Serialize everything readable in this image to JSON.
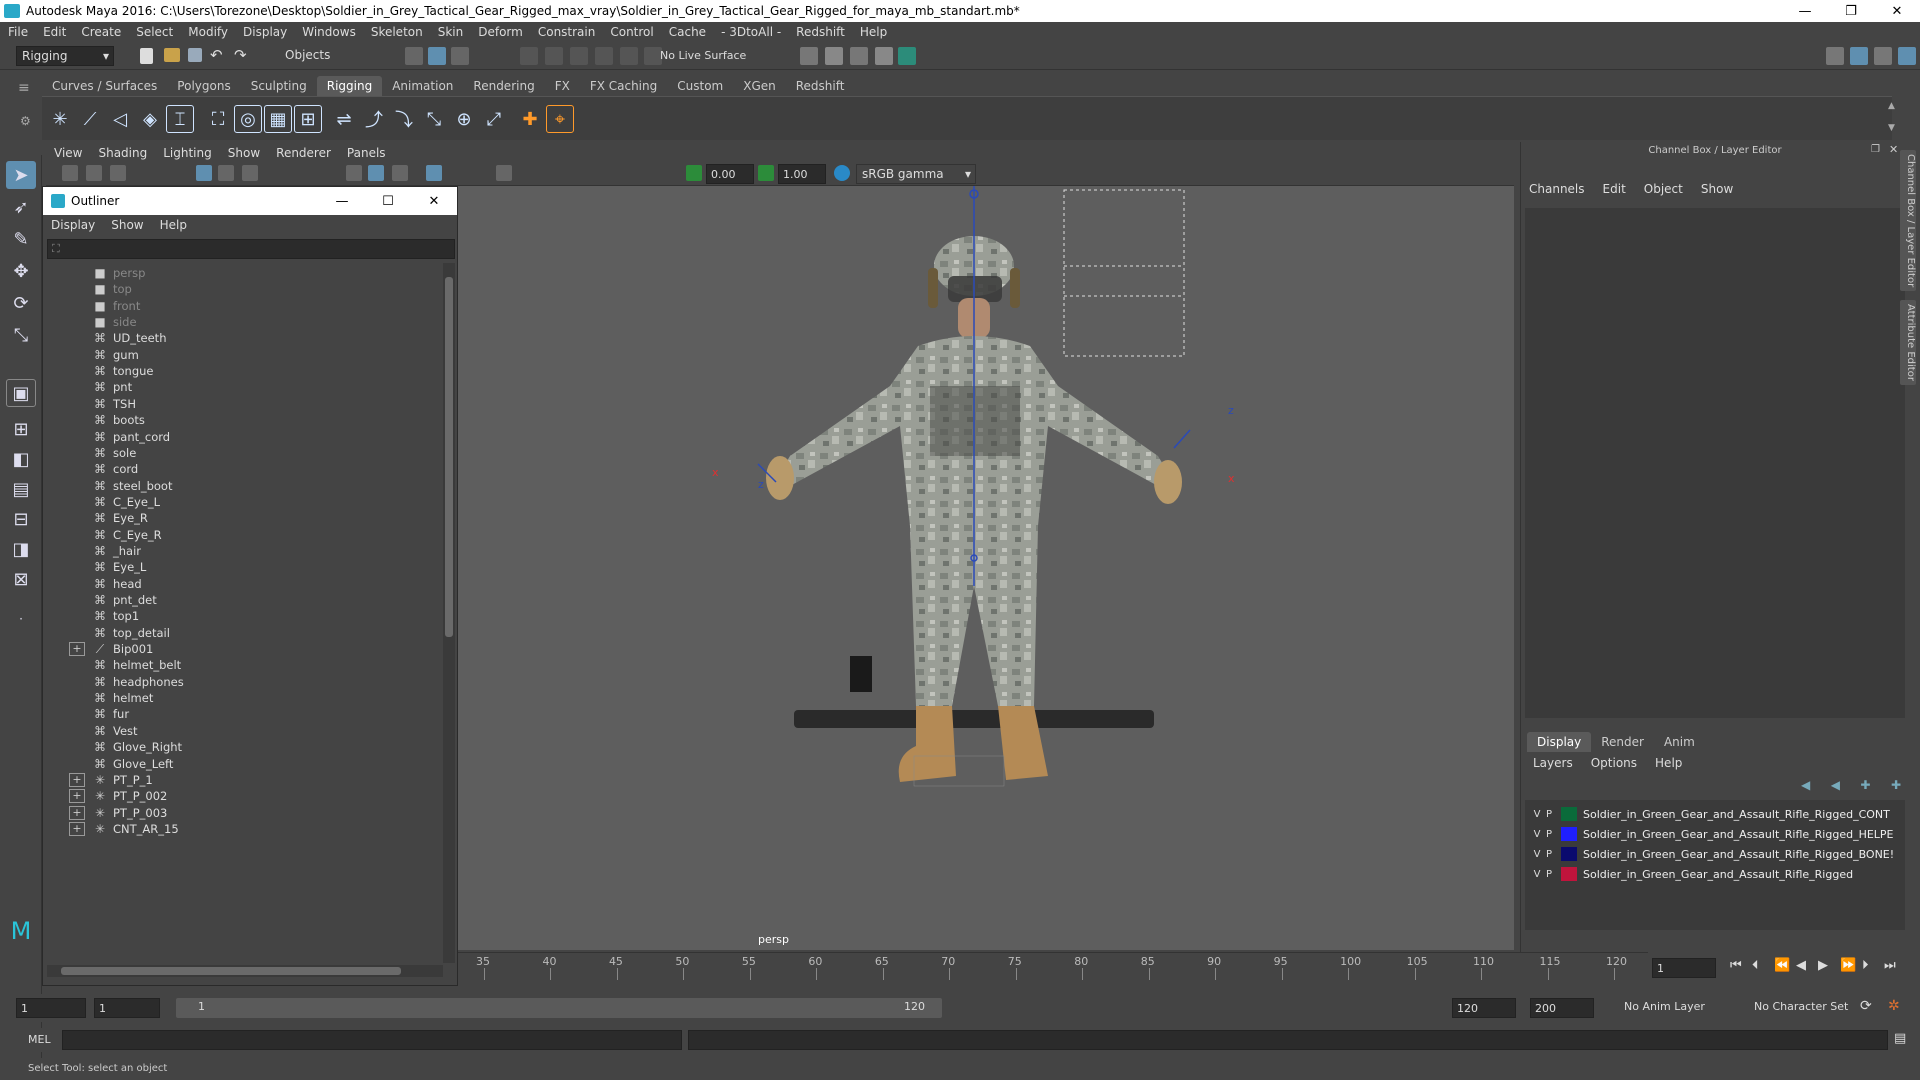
{
  "window": {
    "title": "Autodesk Maya 2016: C:\\Users\\Torezone\\Desktop\\Soldier_in_Grey_Tactical_Gear_Rigged_max_vray\\Soldier_in_Grey_Tactical_Gear_Rigged_for_maya_mb_standart.mb*"
  },
  "menubar": [
    "File",
    "Edit",
    "Create",
    "Select",
    "Modify",
    "Display",
    "Windows",
    "Skeleton",
    "Skin",
    "Deform",
    "Constrain",
    "Control",
    "Cache",
    "- 3DtoAll -",
    "Redshift",
    "Help"
  ],
  "statusline": {
    "menuset": "Rigging",
    "selection_mode": "Objects",
    "live_surface": "No Live Surface"
  },
  "shelf_tabs": [
    "Curves / Surfaces",
    "Polygons",
    "Sculpting",
    "Rigging",
    "Animation",
    "Rendering",
    "FX",
    "FX Caching",
    "Custom",
    "XGen",
    "Redshift"
  ],
  "shelf_active": "Rigging",
  "panel_menu": [
    "View",
    "Shading",
    "Lighting",
    "Show",
    "Renderer",
    "Panels"
  ],
  "panel_tools": {
    "exposure": "0.00",
    "gamma": "1.00",
    "color_space": "sRGB gamma"
  },
  "viewport": {
    "camera_label": "persp"
  },
  "outliner": {
    "title": "Outliner",
    "menu": [
      "Display",
      "Show",
      "Help"
    ],
    "items": [
      {
        "label": "persp",
        "type": "camera",
        "dim": true,
        "expand": false
      },
      {
        "label": "top",
        "type": "camera",
        "dim": true,
        "expand": false
      },
      {
        "label": "front",
        "type": "camera",
        "dim": true,
        "expand": false
      },
      {
        "label": "side",
        "type": "camera",
        "dim": true,
        "expand": false
      },
      {
        "label": "UD_teeth",
        "type": "mesh",
        "dim": false,
        "expand": false
      },
      {
        "label": "gum",
        "type": "mesh",
        "dim": false,
        "expand": false
      },
      {
        "label": "tongue",
        "type": "mesh",
        "dim": false,
        "expand": false
      },
      {
        "label": "pnt",
        "type": "mesh",
        "dim": false,
        "expand": false
      },
      {
        "label": "TSH",
        "type": "mesh",
        "dim": false,
        "expand": false
      },
      {
        "label": "boots",
        "type": "mesh",
        "dim": false,
        "expand": false
      },
      {
        "label": "pant_cord",
        "type": "mesh",
        "dim": false,
        "expand": false
      },
      {
        "label": "sole",
        "type": "mesh",
        "dim": false,
        "expand": false
      },
      {
        "label": "cord",
        "type": "mesh",
        "dim": false,
        "expand": false
      },
      {
        "label": "steel_boot",
        "type": "mesh",
        "dim": false,
        "expand": false
      },
      {
        "label": "C_Eye_L",
        "type": "mesh",
        "dim": false,
        "expand": false
      },
      {
        "label": "Eye_R",
        "type": "mesh",
        "dim": false,
        "expand": false
      },
      {
        "label": "C_Eye_R",
        "type": "mesh",
        "dim": false,
        "expand": false
      },
      {
        "label": "_hair",
        "type": "mesh",
        "dim": false,
        "expand": false
      },
      {
        "label": "Eye_L",
        "type": "mesh",
        "dim": false,
        "expand": false
      },
      {
        "label": "head",
        "type": "mesh",
        "dim": false,
        "expand": false
      },
      {
        "label": "pnt_det",
        "type": "mesh",
        "dim": false,
        "expand": false
      },
      {
        "label": "top1",
        "type": "mesh",
        "dim": false,
        "expand": false
      },
      {
        "label": "top_detail",
        "type": "mesh",
        "dim": false,
        "expand": false
      },
      {
        "label": "Bip001",
        "type": "joint",
        "dim": false,
        "expand": true
      },
      {
        "label": "helmet_belt",
        "type": "mesh",
        "dim": false,
        "expand": false
      },
      {
        "label": "headphones",
        "type": "mesh",
        "dim": false,
        "expand": false
      },
      {
        "label": "helmet",
        "type": "mesh",
        "dim": false,
        "expand": false
      },
      {
        "label": "fur",
        "type": "mesh",
        "dim": false,
        "expand": false
      },
      {
        "label": "Vest",
        "type": "mesh",
        "dim": false,
        "expand": false
      },
      {
        "label": "Glove_Right",
        "type": "mesh",
        "dim": false,
        "expand": false
      },
      {
        "label": "Glove_Left",
        "type": "mesh",
        "dim": false,
        "expand": false
      },
      {
        "label": "PT_P_1",
        "type": "locator",
        "dim": false,
        "expand": true
      },
      {
        "label": "PT_P_002",
        "type": "locator",
        "dim": false,
        "expand": true
      },
      {
        "label": "PT_P_003",
        "type": "locator",
        "dim": false,
        "expand": true
      },
      {
        "label": "CNT_AR_15",
        "type": "locator",
        "dim": false,
        "expand": true
      }
    ]
  },
  "channel_box": {
    "title": "Channel Box / Layer Editor",
    "menu": [
      "Channels",
      "Edit",
      "Object",
      "Show"
    ],
    "side_tabs": [
      "Channel Box / Layer Editor",
      "Attribute Editor"
    ],
    "layer_tabs": [
      "Display",
      "Render",
      "Anim"
    ],
    "layer_active": "Display",
    "layer_menu": [
      "Layers",
      "Options",
      "Help"
    ],
    "layers": [
      {
        "v": "V",
        "p": "P",
        "color": "#0a6b3a",
        "name": "Soldier_in_Green_Gear_and_Assault_Rifle_Rigged_CONT"
      },
      {
        "v": "V",
        "p": "P",
        "color": "#1f1fff",
        "name": "Soldier_in_Green_Gear_and_Assault_Rifle_Rigged_HELPE"
      },
      {
        "v": "V",
        "p": "P",
        "color": "#0a0a6e",
        "name": "Soldier_in_Green_Gear_and_Assault_Rifle_Rigged_BONE!"
      },
      {
        "v": "V",
        "p": "P",
        "color": "#c0143c",
        "name": "Soldier_in_Green_Gear_and_Assault_Rifle_Rigged"
      }
    ]
  },
  "timeline": {
    "ticks": [
      "35",
      "40",
      "45",
      "50",
      "55",
      "60",
      "65",
      "70",
      "75",
      "80",
      "85",
      "90",
      "95",
      "100",
      "105",
      "110",
      "115",
      "120"
    ],
    "current_frame": "1"
  },
  "range": {
    "start": "1",
    "anim_start": "1",
    "range_start": "1",
    "range_end": "120",
    "end": "120",
    "anim_end": "200",
    "anim_layer": "No Anim Layer",
    "character_set": "No Character Set"
  },
  "command_line": {
    "lang": "MEL"
  },
  "help_line": "Select Tool: select an object"
}
